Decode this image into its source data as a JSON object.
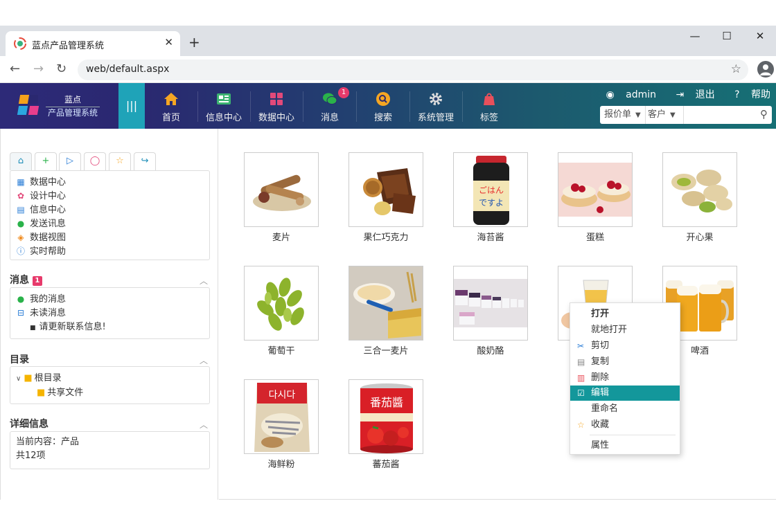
{
  "browser": {
    "tab_title": "蓝点产品管理系统",
    "url": "web/default.aspx"
  },
  "app": {
    "brand_top": "蓝点",
    "brand_bottom": "产品管理系统",
    "nav": [
      {
        "label": "首页",
        "icon": "home-icon"
      },
      {
        "label": "信息中心",
        "icon": "news-icon"
      },
      {
        "label": "数据中心",
        "icon": "grid-icon"
      },
      {
        "label": "消息",
        "icon": "chat-icon",
        "badge": "1"
      },
      {
        "label": "搜索",
        "icon": "search-icon"
      },
      {
        "label": "系统管理",
        "icon": "gear-icon"
      },
      {
        "label": "标签",
        "icon": "tag-icon"
      }
    ],
    "user": "admin",
    "logout": "退出",
    "help": "帮助",
    "filter_type": "报价单",
    "filter_scope": "客户"
  },
  "sidebar": {
    "quick_menu": [
      {
        "label": "数据中心",
        "icon": "grid-icon",
        "color": "#2a7dd6"
      },
      {
        "label": "设计中心",
        "icon": "palette-icon",
        "color": "#e2497a"
      },
      {
        "label": "信息中心",
        "icon": "news-icon",
        "color": "#2a7dd6"
      },
      {
        "label": "发送讯息",
        "icon": "chat-icon",
        "color": "#2ab24a"
      },
      {
        "label": "数据视图",
        "icon": "layers-icon",
        "color": "#f08a1c"
      },
      {
        "label": "实时帮助",
        "icon": "help-icon",
        "color": "#2a7dd6"
      }
    ],
    "messages": {
      "title": "消息",
      "badge": "1",
      "my_messages": "我的消息",
      "unread": "未读消息",
      "unread_item": "请更新联系信息!"
    },
    "directory": {
      "title": "目录",
      "root": "根目录",
      "child": "共享文件"
    },
    "details": {
      "title": "详细信息",
      "current": "当前内容：产品",
      "count": "共12项"
    }
  },
  "products": [
    {
      "name": "麦片"
    },
    {
      "name": "果仁巧克力"
    },
    {
      "name": "海苔酱"
    },
    {
      "name": "蛋糕"
    },
    {
      "name": "开心果"
    },
    {
      "name": "葡萄干"
    },
    {
      "name": "三合一麦片"
    },
    {
      "name": "酸奶酪"
    },
    {
      "name": ""
    },
    {
      "name": "啤酒"
    },
    {
      "name": "海鲜粉"
    },
    {
      "name": "蕃茄酱"
    }
  ],
  "context_menu": {
    "open": "打开",
    "open_inplace": "就地打开",
    "cut": "剪切",
    "copy": "复制",
    "delete": "删除",
    "edit": "编辑",
    "rename": "重命名",
    "favorite": "收藏",
    "properties": "属性"
  },
  "colors": {
    "accent": "#13979b",
    "header_start": "#2d2a78",
    "header_end": "#167075",
    "badge": "#e73a6b"
  }
}
